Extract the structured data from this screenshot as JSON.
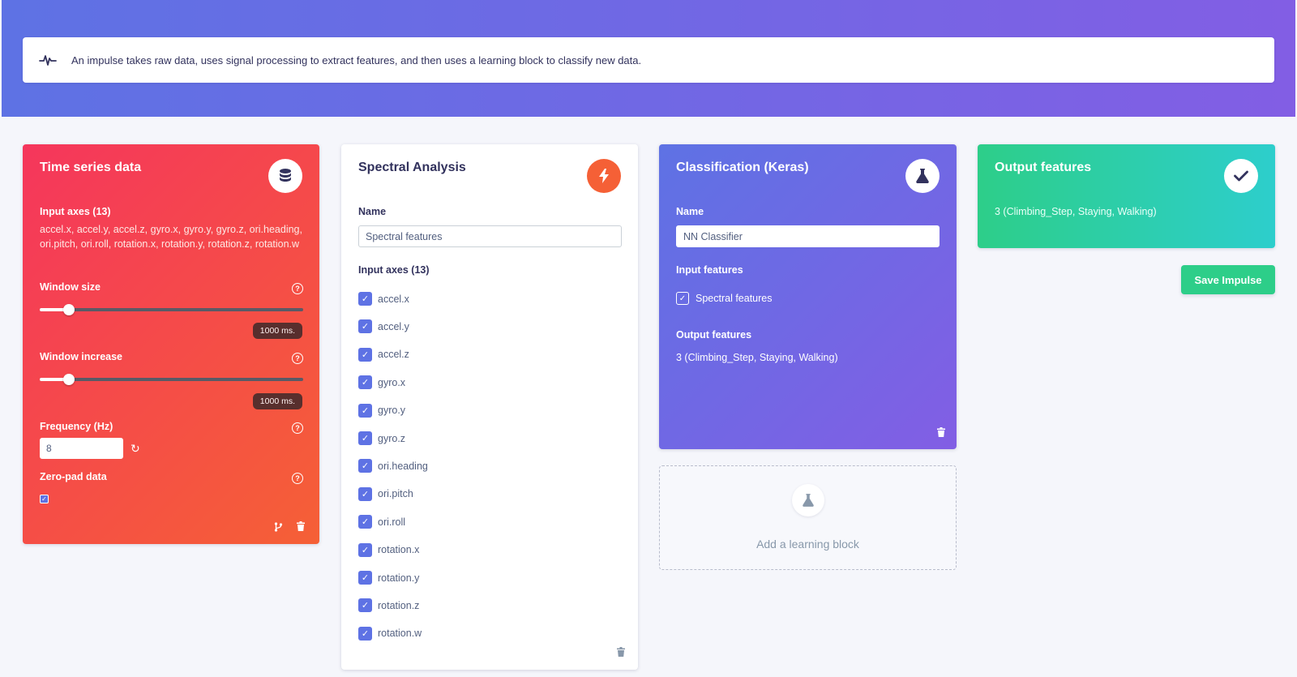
{
  "info": {
    "text": "An impulse takes raw data, uses signal processing to extract features, and then uses a learning block to classify new data.",
    "icon": "pulse-icon"
  },
  "time_series": {
    "title": "Time series data",
    "icon": "database-icon",
    "input_axes_label": "Input axes (13)",
    "input_axes_value": "accel.x, accel.y, accel.z, gyro.x, gyro.y, gyro.z, ori.heading, ori.pitch, ori.roll, rotation.x, rotation.y, rotation.z, rotation.w",
    "window_size_label": "Window size",
    "window_size_value": "1000 ms.",
    "window_size_fraction": 0.11,
    "window_increase_label": "Window increase",
    "window_increase_value": "1000 ms.",
    "window_increase_fraction": 0.11,
    "frequency_label": "Frequency (Hz)",
    "frequency_value": "8",
    "zero_pad_label": "Zero-pad data",
    "zero_pad_checked": true
  },
  "spectral": {
    "title": "Spectral Analysis",
    "icon": "lightning-icon",
    "name_label": "Name",
    "name_value": "Spectral features",
    "input_axes_label": "Input axes (13)",
    "axes": [
      "accel.x",
      "accel.y",
      "accel.z",
      "gyro.x",
      "gyro.y",
      "gyro.z",
      "ori.heading",
      "ori.pitch",
      "ori.roll",
      "rotation.x",
      "rotation.y",
      "rotation.z",
      "rotation.w"
    ]
  },
  "classification": {
    "title": "Classification (Keras)",
    "icon": "flask-icon",
    "name_label": "Name",
    "name_value": "NN Classifier",
    "input_features_label": "Input features",
    "input_feature": "Spectral features",
    "output_features_label": "Output features",
    "output_features_value": "3 (Climbing_Step, Staying, Walking)"
  },
  "add_block": {
    "label": "Add a learning block",
    "icon": "flask-icon"
  },
  "output": {
    "title": "Output features",
    "icon": "check-icon",
    "value": "3 (Climbing_Step, Staying, Walking)"
  },
  "save_button": "Save Impulse",
  "colors": {
    "primary": "#5e72e4",
    "danger": "#f5365c",
    "warning": "#fb6340",
    "success": "#2dce89",
    "teal": "#2dcecc"
  }
}
